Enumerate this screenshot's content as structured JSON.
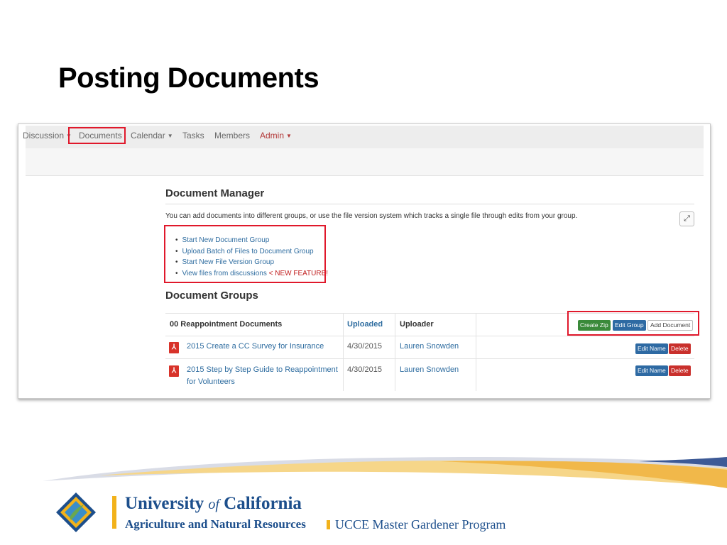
{
  "slide": {
    "title": "Posting Documents"
  },
  "nav": {
    "items": [
      "Discussion",
      "Documents",
      "Calendar",
      "Tasks",
      "Members",
      "Admin"
    ]
  },
  "document_manager": {
    "title": "Document Manager",
    "description": "You can add documents into different groups, or use the file version system which tracks a single file through edits from your group.",
    "links": [
      "Start New Document Group",
      "Upload Batch of Files to Document Group",
      "Start New File Version Group",
      "View files from discussions"
    ],
    "new_feature_label": "< NEW FEATURE!"
  },
  "document_groups": {
    "title": "Document Groups",
    "group_name": "00 Reappointment Documents",
    "columns": {
      "uploaded": "Uploaded",
      "uploader": "Uploader"
    },
    "actions": {
      "create_zip": "Create Zip",
      "edit_group": "Edit Group",
      "add_document": "Add Document"
    },
    "rows": [
      {
        "name": "2015 Create a CC Survey for Insurance",
        "uploaded": "4/30/2015",
        "uploader": "Lauren Snowden"
      },
      {
        "name": "2015 Step by Step Guide to Reappointment for Volunteers",
        "uploaded": "4/30/2015",
        "uploader": "Lauren Snowden"
      }
    ],
    "row_actions": {
      "edit_name": "Edit Name",
      "delete": "Delete"
    }
  },
  "footer": {
    "university": "University",
    "of": "of",
    "california": "California",
    "division": "Agriculture and Natural Resources",
    "program": "UCCE Master Gardener Program"
  },
  "colors": {
    "accent_red": "#e0182b",
    "link_blue": "#2f6da0",
    "brand_blue": "#1d4f8c",
    "gold": "#f2b21b"
  }
}
